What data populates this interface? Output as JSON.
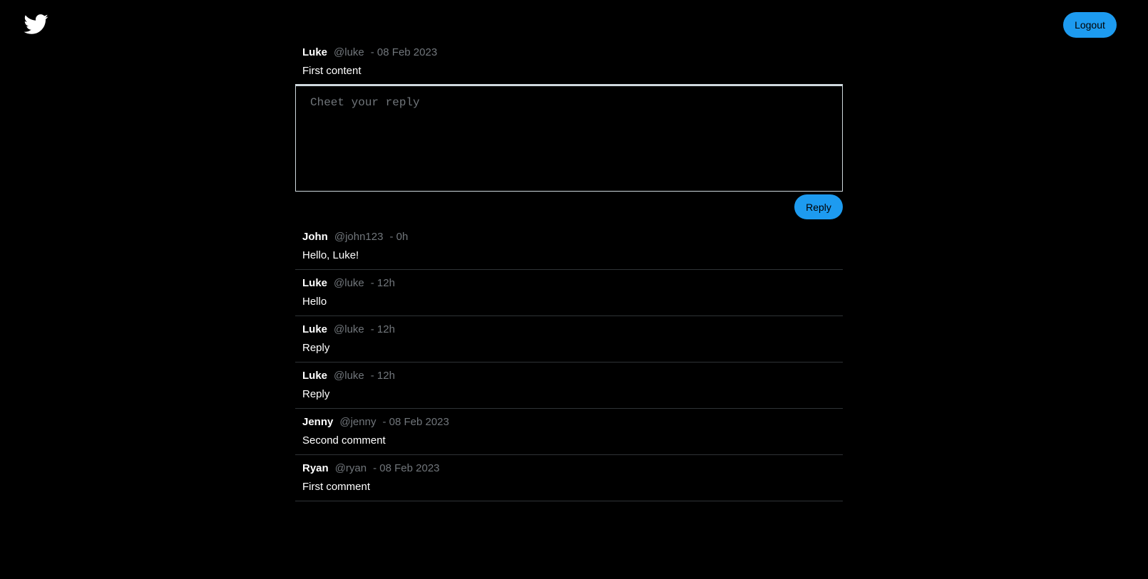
{
  "header": {
    "logo_icon": "twitter-bird-icon",
    "logout_label": "Logout"
  },
  "colors": {
    "accent": "#1d9bf0",
    "background": "#000000",
    "muted_text": "#71767b",
    "divider": "#2f3336"
  },
  "post": {
    "name": "Luke",
    "handle": "@luke",
    "time": "- 08 Feb 2023",
    "content": "First content"
  },
  "reply_form": {
    "placeholder": "Cheet your reply",
    "value": "",
    "submit_label": "Reply"
  },
  "comments": [
    {
      "name": "John",
      "handle": "@john123",
      "time": "- 0h",
      "content": "Hello, Luke!"
    },
    {
      "name": "Luke",
      "handle": "@luke",
      "time": "- 12h",
      "content": "Hello"
    },
    {
      "name": "Luke",
      "handle": "@luke",
      "time": "- 12h",
      "content": "Reply"
    },
    {
      "name": "Luke",
      "handle": "@luke",
      "time": "- 12h",
      "content": "Reply"
    },
    {
      "name": "Jenny",
      "handle": "@jenny",
      "time": "- 08 Feb 2023",
      "content": "Second comment"
    },
    {
      "name": "Ryan",
      "handle": "@ryan",
      "time": "- 08 Feb 2023",
      "content": "First comment"
    }
  ]
}
